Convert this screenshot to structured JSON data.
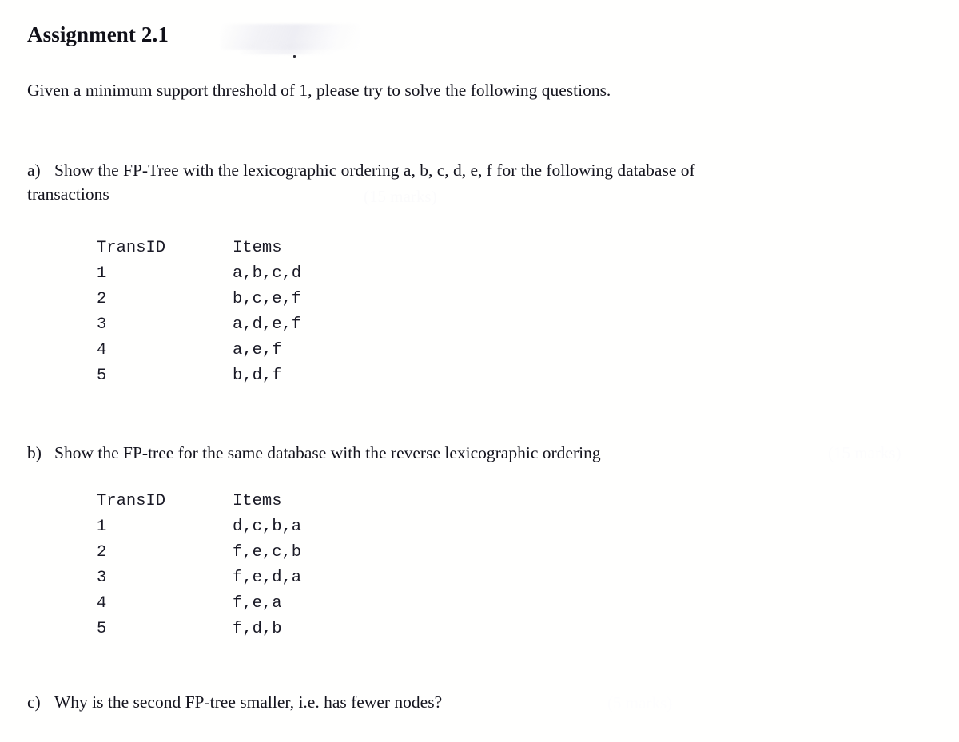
{
  "document": {
    "title": "Assignment 2.1",
    "intro": "Given a minimum support threshold of 1, please try to solve the following questions.",
    "background_color": "#fffffe",
    "text_color": "#14141e"
  },
  "questions": [
    {
      "label": "a)",
      "text": "Show the FP-Tree with the lexicographic ordering a, b, c, d, e, f  for the following database of transactions",
      "ghost_note": "(15 marks)"
    },
    {
      "label": "b)",
      "text": "Show the FP-tree for the same database with the reverse lexicographic ordering",
      "ghost_note": "(15 marks)"
    },
    {
      "label": "c)",
      "text": "Why is the second FP-tree smaller, i.e. has fewer nodes?",
      "ghost_note": "(5 marks)"
    }
  ],
  "tables": [
    {
      "name": "transactions-lexicographic",
      "headers": [
        "TransID",
        "Items"
      ],
      "rows": [
        {
          "id": "1",
          "items": "a,b,c,d"
        },
        {
          "id": "2",
          "items": "b,c,e,f"
        },
        {
          "id": "3",
          "items": "a,d,e,f"
        },
        {
          "id": "4",
          "items": "a,e,f"
        },
        {
          "id": "5",
          "items": "b,d,f"
        }
      ]
    },
    {
      "name": "transactions-reverse-lexicographic",
      "headers": [
        "TransID",
        "Items"
      ],
      "rows": [
        {
          "id": "1",
          "items": "d,c,b,a"
        },
        {
          "id": "2",
          "items": "f,e,c,b"
        },
        {
          "id": "3",
          "items": "f,e,d,a"
        },
        {
          "id": "4",
          "items": "f,e,a"
        },
        {
          "id": "5",
          "items": "f,d,b"
        }
      ]
    }
  ]
}
